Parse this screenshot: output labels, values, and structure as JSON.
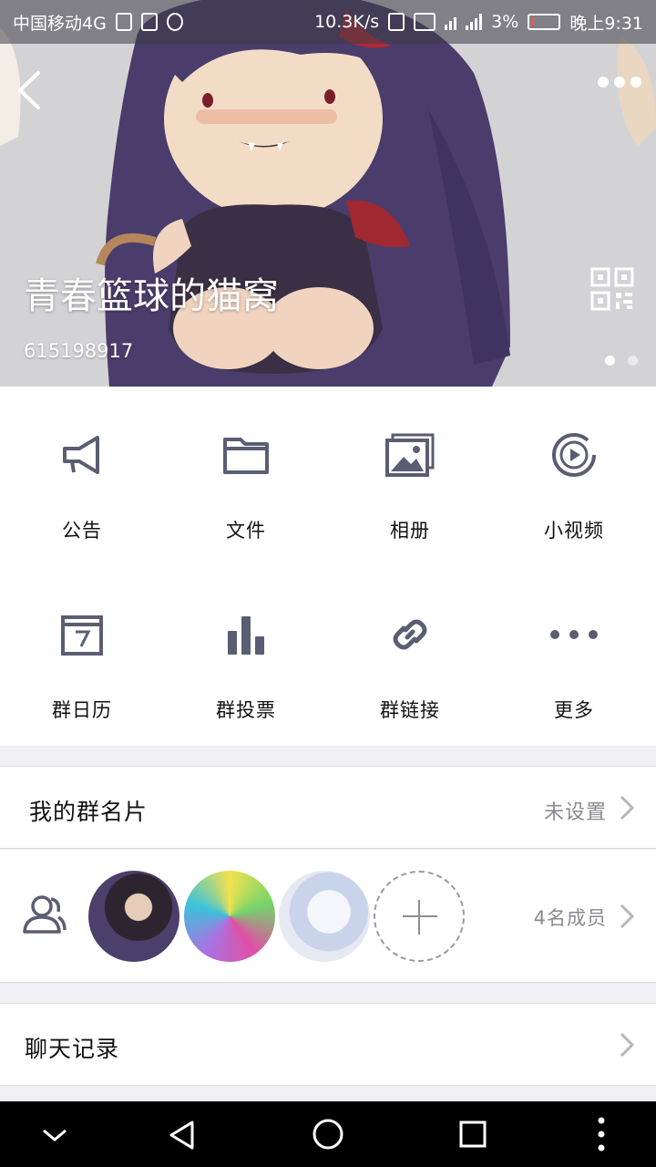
{
  "status_bar": {
    "carrier": "中国移动4G",
    "net_speed": "10.3K/s",
    "battery": "3%",
    "time": "晚上9:31"
  },
  "header": {
    "group_name": "青春篮球的猫窝",
    "group_id": "615198917",
    "page_indicator": {
      "count": 2,
      "active": 1
    }
  },
  "features": [
    {
      "label": "公告",
      "icon": "megaphone-icon"
    },
    {
      "label": "文件",
      "icon": "folder-icon"
    },
    {
      "label": "相册",
      "icon": "album-icon"
    },
    {
      "label": "小视频",
      "icon": "video-play-icon"
    },
    {
      "label": "群日历",
      "icon": "calendar-icon"
    },
    {
      "label": "群投票",
      "icon": "bar-chart-icon"
    },
    {
      "label": "群链接",
      "icon": "link-icon"
    },
    {
      "label": "更多",
      "icon": "more-dots-icon"
    }
  ],
  "group_card": {
    "title": "我的群名片",
    "value": "未设置"
  },
  "members": {
    "count_label": "4名成员"
  },
  "chat_history": {
    "title": "聊天记录"
  },
  "colors": {
    "icon": "#5a5e73",
    "secondary_text": "#8a8a8f",
    "divider": "#dcdcdf"
  }
}
